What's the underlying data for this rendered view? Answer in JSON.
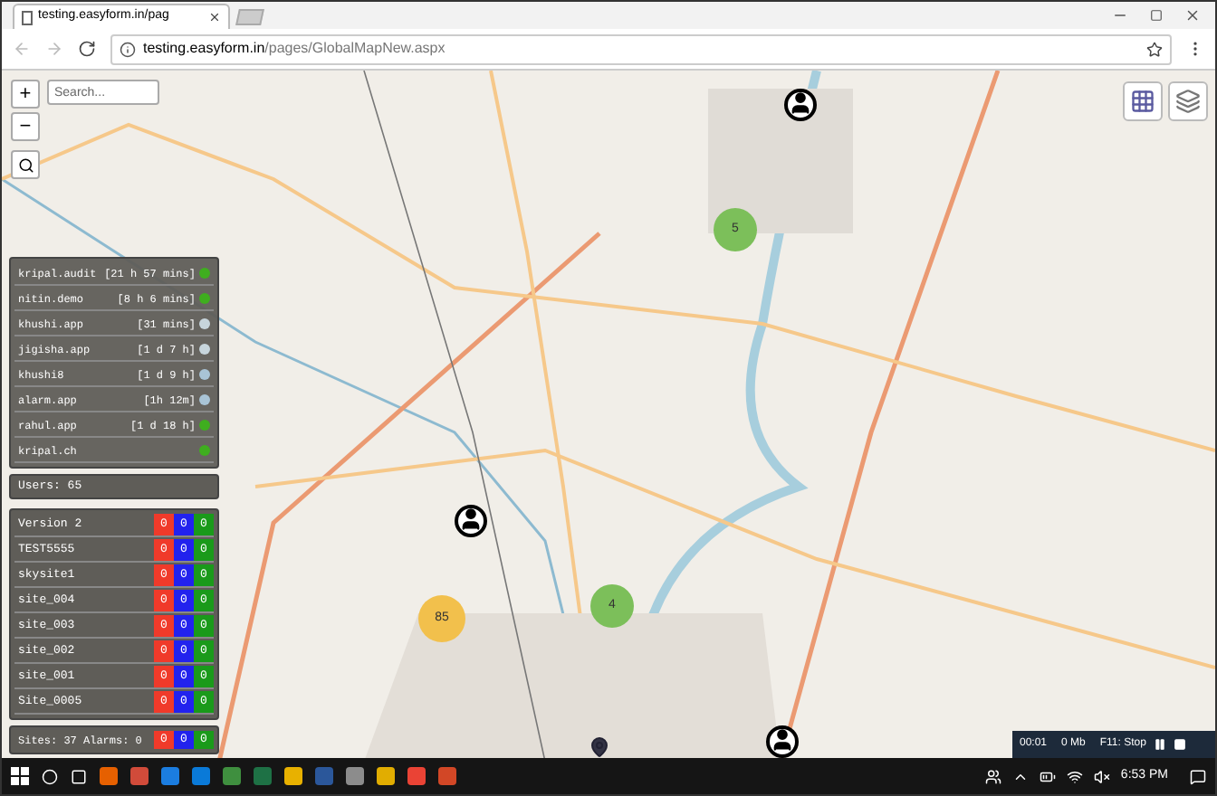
{
  "browser": {
    "tab": {
      "title": "testing.easyform.in/pag"
    },
    "address": {
      "host": "testing.easyform.in",
      "path": "/pages/GlobalMapNew.aspx"
    }
  },
  "map": {
    "zoom_in": "+",
    "zoom_out": "−",
    "search": {
      "placeholder": "Search..."
    },
    "clusters": [
      {
        "count": "5",
        "color": "#7cbf5a"
      },
      {
        "count": "4",
        "color": "#7cbf5a"
      },
      {
        "count": "85",
        "color": "#f2c04c"
      }
    ]
  },
  "users": [
    {
      "name": "kripal.audit",
      "time": "[21 h 57 mins]",
      "color": "#3fae1f"
    },
    {
      "name": "nitin.demo",
      "time": "[8 h 6 mins]",
      "color": "#3fae1f"
    },
    {
      "name": "khushi.app",
      "time": "[31 mins]",
      "color": "#c7d5dc"
    },
    {
      "name": "jigisha.app",
      "time": "[1 d 7 h]",
      "color": "#c7d5dc"
    },
    {
      "name": "khushi8",
      "time": "[1 d 9 h]",
      "color": "#a9c4d6"
    },
    {
      "name": "alarm.app",
      "time": "[1h 12m]",
      "color": "#a9c4d6"
    },
    {
      "name": "rahul.app",
      "time": "[1 d 18 h]",
      "color": "#3fae1f"
    },
    {
      "name": "kripal.ch",
      "color": "#3fae1f"
    }
  ],
  "users_total": "Users: 65",
  "sites": [
    {
      "name": "Version 2",
      "counts": [
        "0",
        "0",
        "0"
      ]
    },
    {
      "name": "TEST5555",
      "counts": [
        "0",
        "0",
        "0"
      ]
    },
    {
      "name": "skysite1",
      "counts": [
        "0",
        "0",
        "0"
      ]
    },
    {
      "name": "site_004",
      "counts": [
        "0",
        "0",
        "0"
      ]
    },
    {
      "name": "site_003",
      "counts": [
        "0",
        "0",
        "0"
      ]
    },
    {
      "name": "site_002",
      "counts": [
        "0",
        "0",
        "0"
      ]
    },
    {
      "name": "site_001",
      "counts": [
        "0",
        "0",
        "0"
      ]
    },
    {
      "name": "Site_0005",
      "counts": [
        "0",
        "0",
        "0"
      ]
    }
  ],
  "summary": {
    "label": "Sites: 37 Alarms: 0",
    "counts": [
      "0",
      "0",
      "0"
    ]
  },
  "recorder": {
    "time": "00:01",
    "size": "0 Mb",
    "stop": "F11: Stop"
  },
  "taskbar": {
    "clock": "6:53 PM"
  }
}
